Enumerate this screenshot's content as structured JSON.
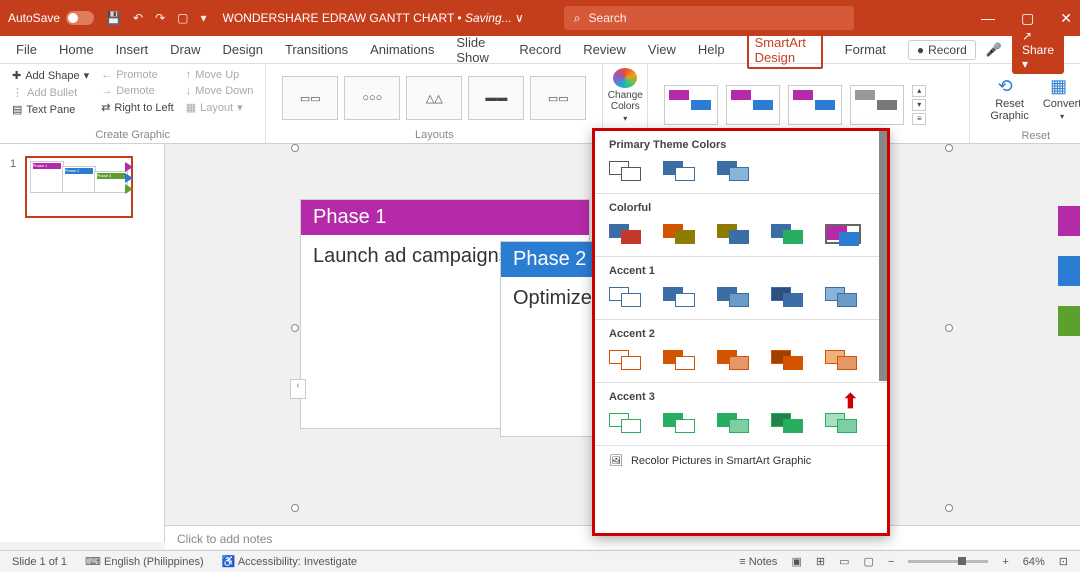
{
  "titleBar": {
    "autosave": "AutoSave",
    "docTitle": "WONDERSHARE EDRAW GANTT CHART",
    "saving": "Saving...",
    "searchPlaceholder": "Search"
  },
  "tabs": {
    "file": "File",
    "home": "Home",
    "insert": "Insert",
    "draw": "Draw",
    "design": "Design",
    "transitions": "Transitions",
    "animations": "Animations",
    "slideShow": "Slide Show",
    "record": "Record",
    "review": "Review",
    "view": "View",
    "help": "Help",
    "smartartDesign": "SmartArt Design",
    "format": "Format",
    "recordBtn": "Record",
    "shareBtn": "Share"
  },
  "ribbon": {
    "addShape": "Add Shape",
    "addBullet": "Add Bullet",
    "textPane": "Text Pane",
    "promote": "Promote",
    "demote": "Demote",
    "rtl": "Right to Left",
    "moveUp": "Move Up",
    "moveDown": "Move Down",
    "layout": "Layout",
    "createGraphic": "Create Graphic",
    "layouts": "Layouts",
    "changeColors": "Change Colors",
    "resetGraphic": "Reset Graphic",
    "convert": "Convert",
    "reset": "Reset"
  },
  "slide": {
    "phase1Title": "Phase 1",
    "phase1Body": "Launch ad campaigns",
    "phase2Title": "Phase 2",
    "phase2Body": "Optimize"
  },
  "colorDropdown": {
    "primaryTheme": "Primary Theme Colors",
    "colorful": "Colorful",
    "accent1": "Accent 1",
    "accent2": "Accent 2",
    "accent3": "Accent 3",
    "recolor": "Recolor Pictures in SmartArt Graphic"
  },
  "notes": {
    "placeholder": "Click to add notes"
  },
  "statusBar": {
    "slideInfo": "Slide 1 of 1",
    "language": "English (Philippines)",
    "accessibility": "Accessibility: Investigate",
    "notes": "Notes",
    "zoom": "64%"
  },
  "thumbnails": {
    "slide1num": "1"
  }
}
